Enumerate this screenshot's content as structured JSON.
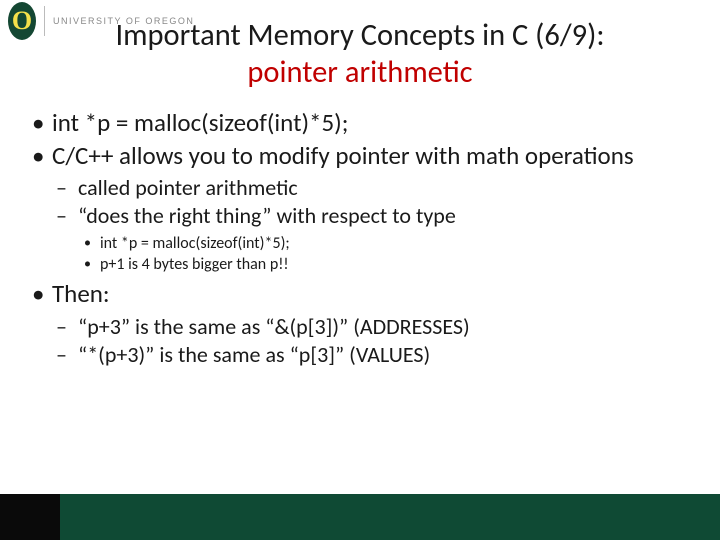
{
  "header": {
    "logo_text": "UNIVERSITY OF OREGON"
  },
  "title": {
    "line1": "Important Memory Concepts in C (6/9):",
    "line2": "pointer arithmetic"
  },
  "bullets": {
    "b1": "int *p = malloc(sizeof(int)*5);",
    "b2": "C/C++ allows you to modify pointer with math operations",
    "b2_sub1": "called pointer arithmetic",
    "b2_sub2": "“does the right thing” with respect to type",
    "b2_sub2_a": "int *p = malloc(sizeof(int)*5);",
    "b2_sub2_b": "p+1 is 4 bytes bigger than p!!",
    "b3": "Then:",
    "b3_sub1": "“p+3” is the same as “&(p[3])” (ADDRESSES)",
    "b3_sub2": "“*(p+3)” is the same as “p[3]” (VALUES)"
  }
}
